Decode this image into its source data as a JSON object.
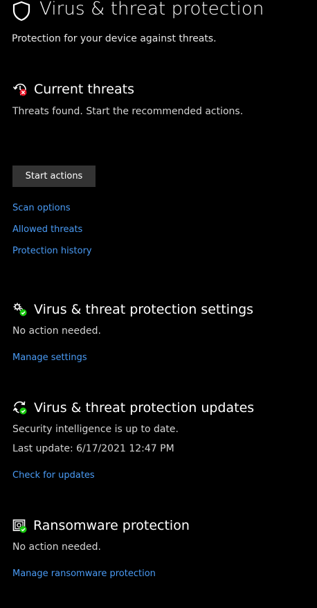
{
  "header": {
    "title": "Virus & threat protection",
    "subtitle": "Protection for your device against threats.",
    "icon": "shield-icon"
  },
  "current_threats": {
    "title": "Current threats",
    "icon": "threat-alert-icon",
    "status_text": "Threats found. Start the recommended actions.",
    "action_button": "Start actions",
    "links": {
      "scan_options": "Scan options",
      "allowed_threats": "Allowed threats",
      "protection_history": "Protection history"
    }
  },
  "settings": {
    "title": "Virus & threat protection settings",
    "icon": "settings-gears-check-icon",
    "status_text": "No action needed.",
    "link": "Manage settings"
  },
  "updates": {
    "title": "Virus & threat protection updates",
    "icon": "refresh-check-icon",
    "status_text": "Security intelligence is up to date.",
    "last_update": "Last update: 6/17/2021 12:47 PM",
    "link": "Check for updates"
  },
  "ransomware": {
    "title": "Ransomware protection",
    "icon": "ransomware-folder-check-icon",
    "status_text": "No action needed.",
    "link": "Manage ransomware protection"
  },
  "colors": {
    "background": "#000000",
    "link": "#4a9bf5",
    "ok_badge": "#16c60c",
    "alert_badge": "#e81123",
    "button": "#333333"
  }
}
